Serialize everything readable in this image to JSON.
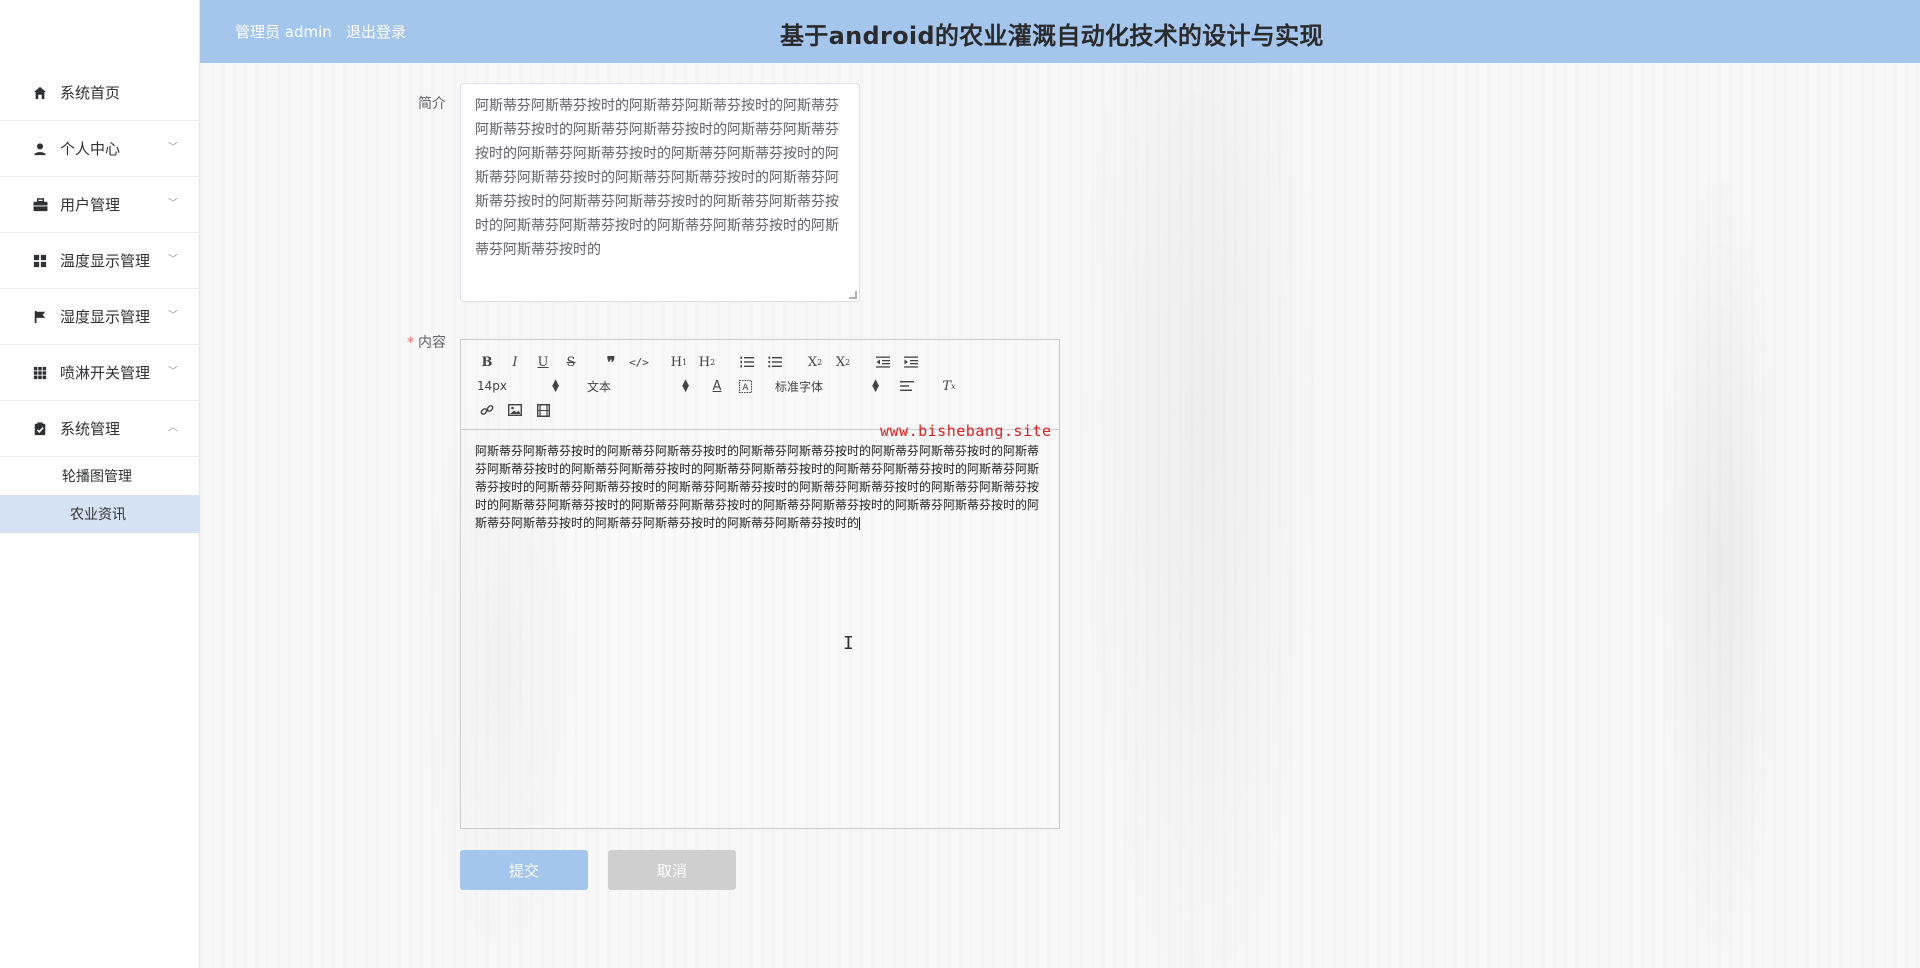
{
  "header": {
    "admin_label": "管理员 admin",
    "logout_label": "退出登录",
    "title": "基于android的农业灌溉自动化技术的设计与实现"
  },
  "sidebar": {
    "items": [
      {
        "label": "系统首页",
        "icon": "home-icon"
      },
      {
        "label": "个人中心",
        "icon": "user-icon"
      },
      {
        "label": "用户管理",
        "icon": "briefcase-icon"
      },
      {
        "label": "温度显示管理",
        "icon": "grid-icon"
      },
      {
        "label": "湿度显示管理",
        "icon": "flag-icon"
      },
      {
        "label": "喷淋开关管理",
        "icon": "apps-icon"
      },
      {
        "label": "系统管理",
        "icon": "clipboard-check-icon"
      }
    ],
    "sub_items": [
      {
        "label": "轮播图管理"
      },
      {
        "label": "农业资讯"
      }
    ],
    "active_sub": "农业资讯"
  },
  "form": {
    "intro_label": "简介",
    "intro_value": "阿斯蒂芬阿斯蒂芬按时的阿斯蒂芬阿斯蒂芬按时的阿斯蒂芬阿斯蒂芬按时的阿斯蒂芬阿斯蒂芬按时的阿斯蒂芬阿斯蒂芬按时的阿斯蒂芬阿斯蒂芬按时的阿斯蒂芬阿斯蒂芬按时的阿斯蒂芬阿斯蒂芬按时的阿斯蒂芬阿斯蒂芬按时的阿斯蒂芬阿斯蒂芬按时的阿斯蒂芬阿斯蒂芬按时的阿斯蒂芬阿斯蒂芬按时的阿斯蒂芬阿斯蒂芬按时的阿斯蒂芬阿斯蒂芬按时的阿斯蒂芬阿斯蒂芬按时的",
    "content_required": "*",
    "content_label": "内容",
    "editor": {
      "font_size": "14px",
      "header_select": "文本",
      "font_family": "标准字体",
      "content": "阿斯蒂芬阿斯蒂芬按时的阿斯蒂芬阿斯蒂芬按时的阿斯蒂芬阿斯蒂芬按时的阿斯蒂芬阿斯蒂芬按时的阿斯蒂芬阿斯蒂芬按时的阿斯蒂芬阿斯蒂芬按时的阿斯蒂芬阿斯蒂芬按时的阿斯蒂芬阿斯蒂芬按时的阿斯蒂芬阿斯蒂芬按时的阿斯蒂芬阿斯蒂芬按时的阿斯蒂芬阿斯蒂芬按时的阿斯蒂芬阿斯蒂芬按时的阿斯蒂芬阿斯蒂芬按时的阿斯蒂芬阿斯蒂芬按时的阿斯蒂芬阿斯蒂芬按时的阿斯蒂芬阿斯蒂芬按时的阿斯蒂芬阿斯蒂芬按时的阿斯蒂芬阿斯蒂芬按时的阿斯蒂芬阿斯蒂芬按时的阿斯蒂芬阿斯蒂芬按时的"
    },
    "submit_label": "提交",
    "cancel_label": "取消"
  },
  "watermark": "www.bishebang.site",
  "colors": {
    "header_bg": "#a4c6ed",
    "active_sub_bg": "#d5e2f3",
    "submit_bg": "#a4c6ed",
    "cancel_bg": "#cfcfcf",
    "watermark": "#e02020"
  }
}
